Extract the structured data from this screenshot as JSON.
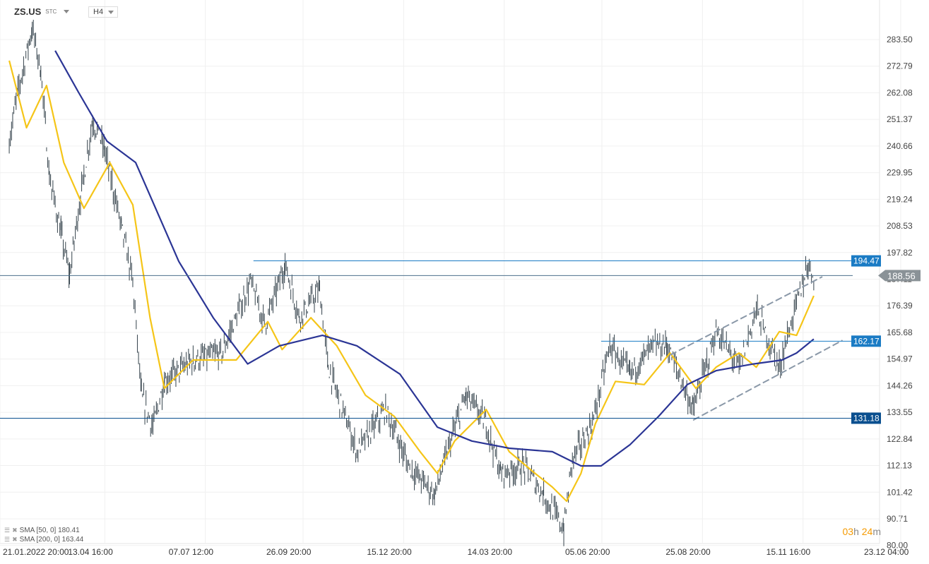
{
  "header": {
    "symbol": "ZS.US",
    "exchange": "STC",
    "timeframe": "H4"
  },
  "legend": [
    {
      "label": "SMA [50,  0] 180.41",
      "color": "#f5c518"
    },
    {
      "label": "SMA [200,  0] 163.44",
      "color": "#2b3595"
    }
  ],
  "timer": {
    "hours": "03",
    "h": "h",
    "minutes": "24",
    "m": "m"
  },
  "colors": {
    "bars": "#34424b",
    "sma50": "#f5c518",
    "sma200": "#2b3595",
    "level": "#1a7bc4",
    "level_dark": "#0a4f8f",
    "price": "#8a9297",
    "channel": "#8a98a8"
  },
  "chart_data": {
    "type": "line",
    "title": "ZS.US H4",
    "ylim": [
      80,
      290
    ],
    "xlim": [
      0,
      312
    ],
    "y_ticks": [
      "283.50",
      "272.79",
      "262.08",
      "251.37",
      "240.66",
      "229.95",
      "219.24",
      "208.53",
      "197.82",
      "187.11",
      "176.39",
      "165.68",
      "154.97",
      "144.26",
      "133.55",
      "122.84",
      "112.13",
      "101.42",
      "90.71",
      "80.00"
    ],
    "x_ticks": [
      {
        "label": "21.01.2022  20:00",
        "x": 0
      },
      {
        "label": "13.04  16:00",
        "x": 35
      },
      {
        "label": "07.07  12:00",
        "x": 70
      },
      {
        "label": "26.09  20:00",
        "x": 104
      },
      {
        "label": "15.12  20:00",
        "x": 139
      },
      {
        "label": "14.03  20:00",
        "x": 174
      },
      {
        "label": "05.06  20:00",
        "x": 208
      },
      {
        "label": "25.08  20:00",
        "x": 243
      },
      {
        "label": "15.11  16:00",
        "x": 278
      },
      {
        "label": "23.12  04:00",
        "x": 312
      }
    ],
    "series": [
      {
        "name": "Price",
        "points": [
          [
            1,
            242.6
          ],
          [
            4,
            262.5
          ],
          [
            9,
            288
          ],
          [
            12,
            271
          ],
          [
            15,
            228
          ],
          [
            19,
            205.7
          ],
          [
            22,
            188.7
          ],
          [
            25,
            214
          ],
          [
            30,
            251
          ],
          [
            34,
            240
          ],
          [
            40,
            208.5
          ],
          [
            44,
            186
          ],
          [
            47,
            140
          ],
          [
            51,
            127.6
          ],
          [
            55,
            146
          ],
          [
            65,
            154.6
          ],
          [
            75,
            157.4
          ],
          [
            85,
            186
          ],
          [
            90,
            168.8
          ],
          [
            97,
            193
          ],
          [
            102,
            171.6
          ],
          [
            109,
            183
          ],
          [
            112,
            151.7
          ],
          [
            122,
            117.7
          ],
          [
            132,
            134.7
          ],
          [
            140,
            112
          ],
          [
            149,
            100.6
          ],
          [
            155,
            123.4
          ],
          [
            160,
            140.4
          ],
          [
            167,
            129
          ],
          [
            172,
            109
          ],
          [
            180,
            112
          ],
          [
            187,
            100.6
          ],
          [
            194,
            86.5
          ],
          [
            197,
            114.8
          ],
          [
            204,
            129
          ],
          [
            210,
            160.3
          ],
          [
            217,
            149
          ],
          [
            225,
            160.3
          ],
          [
            230,
            160.3
          ],
          [
            239,
            134.7
          ],
          [
            247,
            166
          ],
          [
            255,
            151.7
          ],
          [
            261,
            174.5
          ],
          [
            269,
            151.7
          ],
          [
            275,
            177.3
          ],
          [
            279,
            193
          ],
          [
            281,
            188.6
          ]
        ]
      },
      {
        "name": "SMA [50, 0]",
        "points": [
          [
            1,
            275
          ],
          [
            7,
            248
          ],
          [
            14,
            265
          ],
          [
            20,
            234
          ],
          [
            27,
            215.6
          ],
          [
            36,
            234
          ],
          [
            44,
            217
          ],
          [
            50,
            171.6
          ],
          [
            55,
            143.2
          ],
          [
            65,
            154.6
          ],
          [
            80,
            154.6
          ],
          [
            91,
            170
          ],
          [
            96,
            158.8
          ],
          [
            106,
            171.6
          ],
          [
            115,
            160.3
          ],
          [
            125,
            140.4
          ],
          [
            135,
            131.9
          ],
          [
            144,
            117.7
          ],
          [
            150,
            109
          ],
          [
            156,
            122
          ],
          [
            167,
            134.7
          ],
          [
            175,
            117.7
          ],
          [
            184,
            109
          ],
          [
            190,
            103.5
          ],
          [
            195,
            97.8
          ],
          [
            200,
            109
          ],
          [
            205,
            129
          ],
          [
            212,
            146
          ],
          [
            222,
            144.7
          ],
          [
            231,
            157.4
          ],
          [
            240,
            143.2
          ],
          [
            247,
            151.7
          ],
          [
            255,
            157.4
          ],
          [
            261,
            151.7
          ],
          [
            269,
            166
          ],
          [
            275,
            164.5
          ],
          [
            281,
            180.4
          ]
        ]
      },
      {
        "name": "SMA [200, 0]",
        "points": [
          [
            17,
            279
          ],
          [
            25,
            262.5
          ],
          [
            35,
            242.6
          ],
          [
            45,
            234
          ],
          [
            60,
            194.3
          ],
          [
            72,
            171.6
          ],
          [
            84,
            153
          ],
          [
            95,
            160.3
          ],
          [
            110,
            164.5
          ],
          [
            122,
            160.3
          ],
          [
            137,
            148.9
          ],
          [
            150,
            127.6
          ],
          [
            162,
            122
          ],
          [
            175,
            119.1
          ],
          [
            190,
            117.7
          ],
          [
            200,
            112
          ],
          [
            207,
            112
          ],
          [
            217,
            120.5
          ],
          [
            227,
            131.9
          ],
          [
            237,
            144.7
          ],
          [
            247,
            150.3
          ],
          [
            260,
            153
          ],
          [
            270,
            154.6
          ],
          [
            275,
            157.4
          ],
          [
            281,
            163
          ]
        ]
      }
    ],
    "levels": [
      {
        "value": 194.47,
        "label": "194.47",
        "from": 86,
        "style": "blue"
      },
      {
        "value": 188.56,
        "label": "188.56",
        "from": 0,
        "style": "price"
      },
      {
        "value": 162.17,
        "label": "162.17",
        "from": 207,
        "style": "blue"
      },
      {
        "value": 131.18,
        "label": "131.18",
        "from": 0,
        "style": "dark"
      }
    ],
    "channel": [
      {
        "from": [
          231,
          156.6
        ],
        "to": [
          284,
          188.1
        ]
      },
      {
        "from": [
          239,
          130.4
        ],
        "to": [
          291,
          162.5
        ]
      }
    ]
  }
}
